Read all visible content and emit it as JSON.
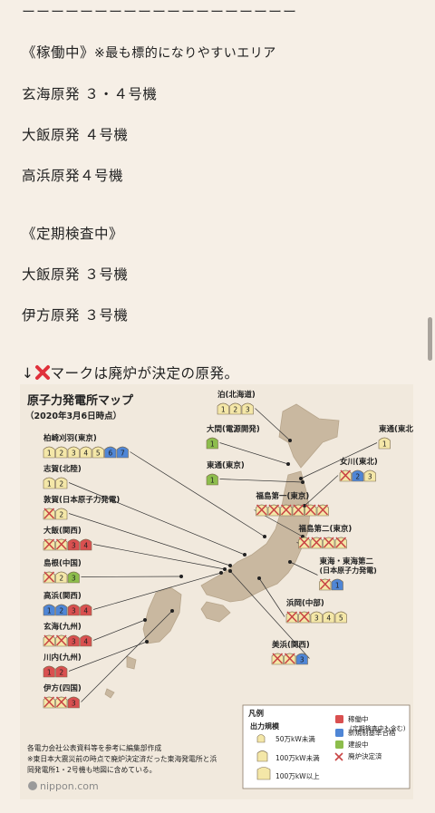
{
  "article": {
    "divider": "ーーーーーーーーーーーーーーーーーーー",
    "operating_heading": "《稼働中》",
    "operating_note": "※最も標的になりやすいエリア",
    "operating_items": [
      "玄海原発 ３・４号機",
      "大飯原発 ４号機",
      "高浜原発４号機"
    ],
    "inspection_heading": "《定期検査中》",
    "inspection_items": [
      "大飯原発 ３号機",
      "伊方原発 ３号機"
    ],
    "legend_line_prefix": "↓",
    "legend_line_text": "マークは廃炉が決定の原発。"
  },
  "map": {
    "title": "原子力発電所マップ",
    "date": "（2020年3月6日時点）",
    "footnote_1": "各電力会社公表資料等を参考に編集部作成",
    "footnote_2": "※東日本大震災前の時点で廃炉決定済だった東海発電所と浜",
    "footnote_3": "岡発電所1・2号機も地図に含めている。",
    "source": "nippon.com",
    "legend": {
      "title": "凡例",
      "output_title": "出力規模",
      "sizes": [
        "50万kW未満",
        "100万kW未満",
        "100万kW以上"
      ],
      "statuses": [
        "稼働中",
        "(定期検査中も含む)",
        "新規制基準合格",
        "建設中",
        "廃炉決定済"
      ]
    },
    "colors": {
      "operating": "#d95050",
      "approved": "#4f86d6",
      "construction": "#8dbd4c",
      "standby": "#f4e7a8",
      "decommissioned_x": "#c94545"
    },
    "plants": [
      {
        "name": "泊(北海道)",
        "units": [
          "1",
          "2",
          "3"
        ],
        "status": [
          "s",
          "s",
          "s"
        ]
      },
      {
        "name": "大間(電源開発)",
        "units": [
          "1"
        ],
        "status": [
          "c"
        ]
      },
      {
        "name": "東通(東北)",
        "units": [
          "1"
        ],
        "status": [
          "s"
        ]
      },
      {
        "name": "東通(東京)",
        "units": [
          "1"
        ],
        "status": [
          "c"
        ]
      },
      {
        "name": "女川(東北)",
        "units": [
          "",
          "2",
          "3"
        ],
        "status": [
          "x",
          "b",
          "s"
        ]
      },
      {
        "name": "福島第一(東京)",
        "units": [
          "",
          "",
          "",
          "",
          "",
          ""
        ],
        "status": [
          "x",
          "x",
          "x",
          "x",
          "x",
          "x"
        ]
      },
      {
        "name": "福島第二(東京)",
        "units": [
          "",
          "",
          "",
          ""
        ],
        "status": [
          "x",
          "x",
          "x",
          "x"
        ]
      },
      {
        "name": "東海・東海第二",
        "sub": "(日本原子力発電)",
        "units": [
          "",
          "1"
        ],
        "status": [
          "x",
          "b"
        ]
      },
      {
        "name": "浜岡(中部)",
        "units": [
          "",
          "",
          "3",
          "4",
          "5"
        ],
        "status": [
          "x",
          "x",
          "s",
          "s",
          "s"
        ]
      },
      {
        "name": "美浜(関西)",
        "units": [
          "",
          "",
          "3"
        ],
        "status": [
          "x",
          "x",
          "b"
        ]
      },
      {
        "name": "柏崎刈羽(東京)",
        "units": [
          "1",
          "2",
          "3",
          "4",
          "5",
          "6",
          "7"
        ],
        "status": [
          "s",
          "s",
          "s",
          "s",
          "s",
          "b",
          "b"
        ]
      },
      {
        "name": "志賀(北陸)",
        "units": [
          "1",
          "2"
        ],
        "status": [
          "s",
          "s"
        ]
      },
      {
        "name": "敦賀(日本原子力発電)",
        "units": [
          "",
          "2"
        ],
        "status": [
          "x",
          "s"
        ]
      },
      {
        "name": "大飯(関西)",
        "units": [
          "",
          "",
          "3",
          "4"
        ],
        "status": [
          "x",
          "x",
          "r",
          "r"
        ]
      },
      {
        "name": "島根(中国)",
        "units": [
          "",
          "2",
          "3"
        ],
        "status": [
          "x",
          "s",
          "c"
        ]
      },
      {
        "name": "高浜(関西)",
        "units": [
          "1",
          "2",
          "3",
          "4"
        ],
        "status": [
          "b",
          "b",
          "r",
          "r"
        ]
      },
      {
        "name": "玄海(九州)",
        "units": [
          "",
          "",
          "3",
          "4"
        ],
        "status": [
          "x",
          "x",
          "r",
          "r"
        ]
      },
      {
        "name": "川内(九州)",
        "units": [
          "1",
          "2"
        ],
        "status": [
          "r",
          "r"
        ]
      },
      {
        "name": "伊方(四国)",
        "units": [
          "",
          "",
          "3"
        ],
        "status": [
          "x",
          "x",
          "r"
        ]
      }
    ]
  }
}
